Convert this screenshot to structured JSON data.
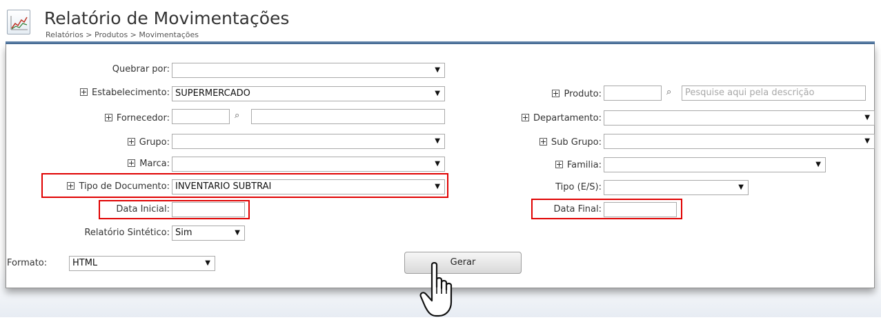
{
  "header": {
    "title": "Relatório de Movimentações",
    "breadcrumb": "Relatórios > Produtos > Movimentações"
  },
  "left": {
    "quebrar": {
      "label": "Quebrar por:",
      "value": ""
    },
    "estabelecimento": {
      "label": "Estabelecimento:",
      "value": "SUPERMERCADO"
    },
    "fornecedor": {
      "label": "Fornecedor:",
      "code": "",
      "desc": ""
    },
    "grupo": {
      "label": "Grupo:",
      "value": ""
    },
    "marca": {
      "label": "Marca:",
      "value": ""
    },
    "tipo_documento": {
      "label": "Tipo de Documento:",
      "value": "INVENTARIO SUBTRAI"
    },
    "data_inicial": {
      "label": "Data Inicial:",
      "value": ""
    },
    "sintetico": {
      "label": "Relatório Sintético:",
      "value": "Sim"
    }
  },
  "right": {
    "produto": {
      "label": "Produto:",
      "code": "",
      "placeholder": "Pesquise aqui pela descrição"
    },
    "departamento": {
      "label": "Departamento:",
      "value": ""
    },
    "sub_grupo": {
      "label": "Sub Grupo:",
      "value": ""
    },
    "familia": {
      "label": "Familia:",
      "value": ""
    },
    "tipo_es": {
      "label": "Tipo (E/S):",
      "value": ""
    },
    "data_final": {
      "label": "Data Final:",
      "value": ""
    }
  },
  "footer": {
    "formato": {
      "label": "Formato:",
      "value": "HTML"
    },
    "gerar_label": "Gerar"
  },
  "colors": {
    "highlight": "#e00000",
    "header_rule": "#3d6490"
  },
  "icons": {
    "page": "line-chart-icon",
    "search": "magnifier-icon",
    "expand": "plus-box-icon",
    "dropdown": "triangle-down-icon",
    "cursor": "hand-pointer-icon"
  }
}
